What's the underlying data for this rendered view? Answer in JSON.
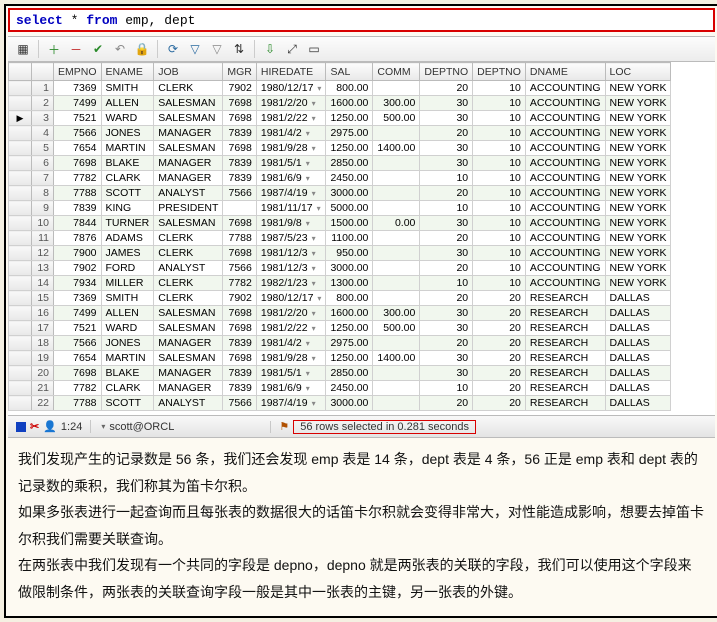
{
  "sql": {
    "kw1": "select",
    "mid": " * ",
    "kw2": "from",
    "tail": " emp, dept"
  },
  "toolbar": {
    "grid": "▦",
    "plus": "＋",
    "minus": "－",
    "check": "✔",
    "undo": "↶",
    "lock": "🔒",
    "refresh": "⟳",
    "filter": "▽",
    "clearfilter": "▽",
    "sort": "⇅",
    "export": "⇩",
    "auto": "⤢",
    "rep": "▭"
  },
  "columns": [
    "EMPNO",
    "ENAME",
    "JOB",
    "MGR",
    "HIREDATE",
    "SAL",
    "COMM",
    "DEPTNO",
    "DEPTNO",
    "DNAME",
    "LOC"
  ],
  "rows": [
    {
      "n": 1,
      "cur": false,
      "EMPNO": 7369,
      "ENAME": "SMITH",
      "JOB": "CLERK",
      "MGR": 7902,
      "HIREDATE": "1980/12/17",
      "SAL": "800.00",
      "COMM": "",
      "DEPTNO": 20,
      "DEPTNO2": 10,
      "DNAME": "ACCOUNTING",
      "LOC": "NEW YORK"
    },
    {
      "n": 2,
      "cur": false,
      "EMPNO": 7499,
      "ENAME": "ALLEN",
      "JOB": "SALESMAN",
      "MGR": 7698,
      "HIREDATE": "1981/2/20",
      "SAL": "1600.00",
      "COMM": "300.00",
      "DEPTNO": 30,
      "DEPTNO2": 10,
      "DNAME": "ACCOUNTING",
      "LOC": "NEW YORK"
    },
    {
      "n": 3,
      "cur": true,
      "EMPNO": 7521,
      "ENAME": "WARD",
      "JOB": "SALESMAN",
      "MGR": 7698,
      "HIREDATE": "1981/2/22",
      "SAL": "1250.00",
      "COMM": "500.00",
      "DEPTNO": 30,
      "DEPTNO2": 10,
      "DNAME": "ACCOUNTING",
      "LOC": "NEW YORK"
    },
    {
      "n": 4,
      "cur": false,
      "EMPNO": 7566,
      "ENAME": "JONES",
      "JOB": "MANAGER",
      "MGR": 7839,
      "HIREDATE": "1981/4/2",
      "SAL": "2975.00",
      "COMM": "",
      "DEPTNO": 20,
      "DEPTNO2": 10,
      "DNAME": "ACCOUNTING",
      "LOC": "NEW YORK"
    },
    {
      "n": 5,
      "cur": false,
      "EMPNO": 7654,
      "ENAME": "MARTIN",
      "JOB": "SALESMAN",
      "MGR": 7698,
      "HIREDATE": "1981/9/28",
      "SAL": "1250.00",
      "COMM": "1400.00",
      "DEPTNO": 30,
      "DEPTNO2": 10,
      "DNAME": "ACCOUNTING",
      "LOC": "NEW YORK"
    },
    {
      "n": 6,
      "cur": false,
      "EMPNO": 7698,
      "ENAME": "BLAKE",
      "JOB": "MANAGER",
      "MGR": 7839,
      "HIREDATE": "1981/5/1",
      "SAL": "2850.00",
      "COMM": "",
      "DEPTNO": 30,
      "DEPTNO2": 10,
      "DNAME": "ACCOUNTING",
      "LOC": "NEW YORK"
    },
    {
      "n": 7,
      "cur": false,
      "EMPNO": 7782,
      "ENAME": "CLARK",
      "JOB": "MANAGER",
      "MGR": 7839,
      "HIREDATE": "1981/6/9",
      "SAL": "2450.00",
      "COMM": "",
      "DEPTNO": 10,
      "DEPTNO2": 10,
      "DNAME": "ACCOUNTING",
      "LOC": "NEW YORK"
    },
    {
      "n": 8,
      "cur": false,
      "EMPNO": 7788,
      "ENAME": "SCOTT",
      "JOB": "ANALYST",
      "MGR": 7566,
      "HIREDATE": "1987/4/19",
      "SAL": "3000.00",
      "COMM": "",
      "DEPTNO": 20,
      "DEPTNO2": 10,
      "DNAME": "ACCOUNTING",
      "LOC": "NEW YORK"
    },
    {
      "n": 9,
      "cur": false,
      "EMPNO": 7839,
      "ENAME": "KING",
      "JOB": "PRESIDENT",
      "MGR": "",
      "HIREDATE": "1981/11/17",
      "SAL": "5000.00",
      "COMM": "",
      "DEPTNO": 10,
      "DEPTNO2": 10,
      "DNAME": "ACCOUNTING",
      "LOC": "NEW YORK"
    },
    {
      "n": 10,
      "cur": false,
      "EMPNO": 7844,
      "ENAME": "TURNER",
      "JOB": "SALESMAN",
      "MGR": 7698,
      "HIREDATE": "1981/9/8",
      "SAL": "1500.00",
      "COMM": "0.00",
      "DEPTNO": 30,
      "DEPTNO2": 10,
      "DNAME": "ACCOUNTING",
      "LOC": "NEW YORK"
    },
    {
      "n": 11,
      "cur": false,
      "EMPNO": 7876,
      "ENAME": "ADAMS",
      "JOB": "CLERK",
      "MGR": 7788,
      "HIREDATE": "1987/5/23",
      "SAL": "1100.00",
      "COMM": "",
      "DEPTNO": 20,
      "DEPTNO2": 10,
      "DNAME": "ACCOUNTING",
      "LOC": "NEW YORK"
    },
    {
      "n": 12,
      "cur": false,
      "EMPNO": 7900,
      "ENAME": "JAMES",
      "JOB": "CLERK",
      "MGR": 7698,
      "HIREDATE": "1981/12/3",
      "SAL": "950.00",
      "COMM": "",
      "DEPTNO": 30,
      "DEPTNO2": 10,
      "DNAME": "ACCOUNTING",
      "LOC": "NEW YORK"
    },
    {
      "n": 13,
      "cur": false,
      "EMPNO": 7902,
      "ENAME": "FORD",
      "JOB": "ANALYST",
      "MGR": 7566,
      "HIREDATE": "1981/12/3",
      "SAL": "3000.00",
      "COMM": "",
      "DEPTNO": 20,
      "DEPTNO2": 10,
      "DNAME": "ACCOUNTING",
      "LOC": "NEW YORK"
    },
    {
      "n": 14,
      "cur": false,
      "EMPNO": 7934,
      "ENAME": "MILLER",
      "JOB": "CLERK",
      "MGR": 7782,
      "HIREDATE": "1982/1/23",
      "SAL": "1300.00",
      "COMM": "",
      "DEPTNO": 10,
      "DEPTNO2": 10,
      "DNAME": "ACCOUNTING",
      "LOC": "NEW YORK"
    },
    {
      "n": 15,
      "cur": false,
      "EMPNO": 7369,
      "ENAME": "SMITH",
      "JOB": "CLERK",
      "MGR": 7902,
      "HIREDATE": "1980/12/17",
      "SAL": "800.00",
      "COMM": "",
      "DEPTNO": 20,
      "DEPTNO2": 20,
      "DNAME": "RESEARCH",
      "LOC": "DALLAS"
    },
    {
      "n": 16,
      "cur": false,
      "EMPNO": 7499,
      "ENAME": "ALLEN",
      "JOB": "SALESMAN",
      "MGR": 7698,
      "HIREDATE": "1981/2/20",
      "SAL": "1600.00",
      "COMM": "300.00",
      "DEPTNO": 30,
      "DEPTNO2": 20,
      "DNAME": "RESEARCH",
      "LOC": "DALLAS"
    },
    {
      "n": 17,
      "cur": false,
      "EMPNO": 7521,
      "ENAME": "WARD",
      "JOB": "SALESMAN",
      "MGR": 7698,
      "HIREDATE": "1981/2/22",
      "SAL": "1250.00",
      "COMM": "500.00",
      "DEPTNO": 30,
      "DEPTNO2": 20,
      "DNAME": "RESEARCH",
      "LOC": "DALLAS"
    },
    {
      "n": 18,
      "cur": false,
      "EMPNO": 7566,
      "ENAME": "JONES",
      "JOB": "MANAGER",
      "MGR": 7839,
      "HIREDATE": "1981/4/2",
      "SAL": "2975.00",
      "COMM": "",
      "DEPTNO": 20,
      "DEPTNO2": 20,
      "DNAME": "RESEARCH",
      "LOC": "DALLAS"
    },
    {
      "n": 19,
      "cur": false,
      "EMPNO": 7654,
      "ENAME": "MARTIN",
      "JOB": "SALESMAN",
      "MGR": 7698,
      "HIREDATE": "1981/9/28",
      "SAL": "1250.00",
      "COMM": "1400.00",
      "DEPTNO": 30,
      "DEPTNO2": 20,
      "DNAME": "RESEARCH",
      "LOC": "DALLAS"
    },
    {
      "n": 20,
      "cur": false,
      "EMPNO": 7698,
      "ENAME": "BLAKE",
      "JOB": "MANAGER",
      "MGR": 7839,
      "HIREDATE": "1981/5/1",
      "SAL": "2850.00",
      "COMM": "",
      "DEPTNO": 30,
      "DEPTNO2": 20,
      "DNAME": "RESEARCH",
      "LOC": "DALLAS"
    },
    {
      "n": 21,
      "cur": false,
      "EMPNO": 7782,
      "ENAME": "CLARK",
      "JOB": "MANAGER",
      "MGR": 7839,
      "HIREDATE": "1981/6/9",
      "SAL": "2450.00",
      "COMM": "",
      "DEPTNO": 10,
      "DEPTNO2": 20,
      "DNAME": "RESEARCH",
      "LOC": "DALLAS"
    },
    {
      "n": 22,
      "cur": false,
      "EMPNO": 7788,
      "ENAME": "SCOTT",
      "JOB": "ANALYST",
      "MGR": 7566,
      "HIREDATE": "1987/4/19",
      "SAL": "3000.00",
      "COMM": "",
      "DEPTNO": 20,
      "DEPTNO2": 20,
      "DNAME": "RESEARCH",
      "LOC": "DALLAS"
    }
  ],
  "status": {
    "scissors": "✂",
    "person": "👤",
    "pos": "1:24",
    "conn_label": "scott@ORCL",
    "pin": "⚑",
    "selected": "56 rows selected in 0.281 seconds"
  },
  "prose": {
    "p1": "我们发现产生的记录数是 56 条，我们还会发现 emp 表是 14 条，dept 表是 4 条，56 正是 emp 表和 dept 表的记录数的乘积，我们称其为笛卡尔积。",
    "p2": "如果多张表进行一起查询而且每张表的数据很大的话笛卡尔积就会变得非常大，对性能造成影响，想要去掉笛卡尔积我们需要关联查询。",
    "p3": "在两张表中我们发现有一个共同的字段是 depno，depno 就是两张表的关联的字段，我们可以使用这个字段来做限制条件，两张表的关联查询字段一般是其中一张表的主键，另一张表的外键。"
  }
}
